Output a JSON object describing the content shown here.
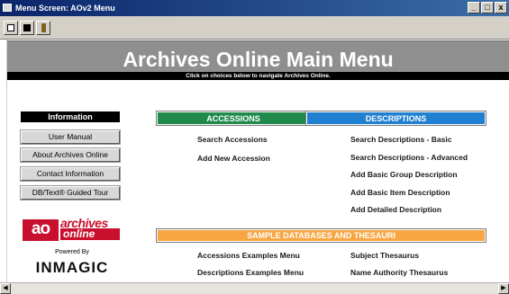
{
  "window": {
    "title": "Menu Screen: AOv2 Menu",
    "buttons": {
      "minimize": "_",
      "maximize": "□",
      "close": "x"
    }
  },
  "banner": {
    "title": "Archives Online Main Menu",
    "subtitle": "Click on choices below to navigate Archives Online."
  },
  "sidebar": {
    "header": "Information",
    "buttons": [
      "User Manual",
      "About Archives Online",
      "Contact Information",
      "DB/Text® Guided Tour"
    ],
    "logo": {
      "mark": "ao",
      "line1": "archives",
      "line2": "online"
    },
    "powered_by": "Powered By",
    "vendor": "INMAGIC"
  },
  "accessions": {
    "header": "ACCESSIONS",
    "links": [
      "Search Accessions",
      "Add New Accession"
    ]
  },
  "descriptions": {
    "header": "DESCRIPTIONS",
    "links": [
      "Search Descriptions - Basic",
      "Search Descriptions - Advanced",
      "Add Basic Group Description",
      "Add Basic Item Description",
      "Add Detailed Description"
    ]
  },
  "sample": {
    "header": "SAMPLE DATABASES AND THESAURI",
    "links": [
      "Accessions Examples Menu",
      "Subject Thesaurus",
      "Descriptions Examples Menu",
      "Name Authority Thesaurus"
    ]
  },
  "colors": {
    "accessions": "#1f8a4c",
    "descriptions": "#1f7fd0",
    "sample": "#f7a642",
    "banner": "#8f8f8f",
    "logo_red": "#c8102e"
  }
}
